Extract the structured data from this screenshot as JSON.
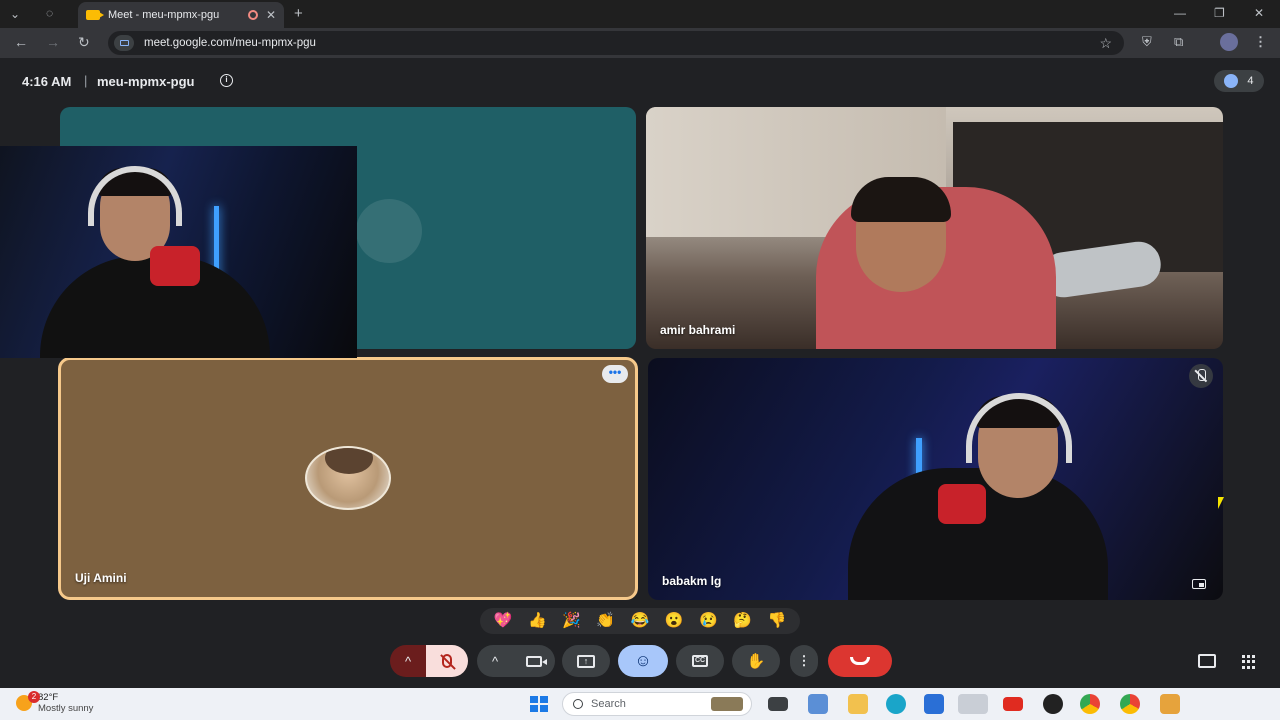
{
  "browser": {
    "tab_title": "Meet - meu-mpmx-pgu",
    "tab_close": "✕",
    "new_tab": "+",
    "url": "meet.google.com/meu-mpmx-pgu",
    "window_minimize": "—",
    "window_restore": "❐",
    "window_close": "✕"
  },
  "meeting": {
    "time": "4:16 AM",
    "separator": "|",
    "code": "meu-mpmx-pgu",
    "info_icon": "i",
    "participant_count": "4"
  },
  "tiles": [
    {
      "name": ""
    },
    {
      "name": "amir bahrami"
    },
    {
      "name": "Uji Amini",
      "more": "•••"
    },
    {
      "name": "babakm lg"
    }
  ],
  "reactions": [
    "💖",
    "👍",
    "🎉",
    "👏",
    "😂",
    "😮",
    "😢",
    "🤔",
    "👎"
  ],
  "controls": {
    "mic_caret": "^",
    "cam_caret": "^",
    "present_arrow": "↑",
    "emoji": "☺",
    "cc": "CC",
    "hand": "✋",
    "more": "⋮"
  },
  "taskbar": {
    "weather_badge": "2",
    "temperature": "82°F",
    "condition": "Mostly sunny",
    "search_placeholder": "Search"
  },
  "colors": {
    "leave_button": "#dc3630",
    "active_tile_border": "#f6c98b",
    "emoji_button": "#a8c7fa"
  }
}
